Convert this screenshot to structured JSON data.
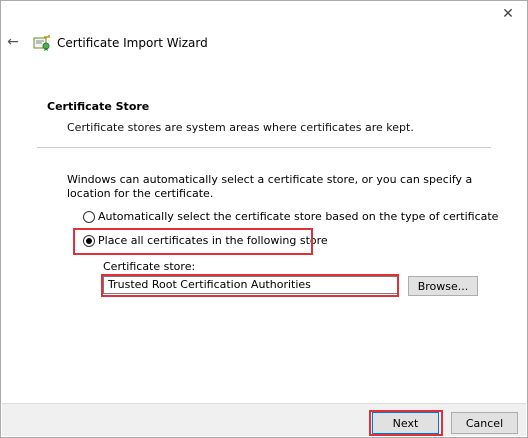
{
  "window": {
    "close_glyph": "✕",
    "back_glyph": "←"
  },
  "header": {
    "title": "Certificate Import Wizard",
    "icon": "certificate-wizard-icon"
  },
  "section": {
    "title": "Certificate Store",
    "description": "Certificate stores are system areas where certificates are kept."
  },
  "intro": "Windows can automatically select a certificate store, or you can specify a location for the certificate.",
  "options": {
    "auto_label": "Automatically select the certificate store based on the type of certificate",
    "auto_selected": false,
    "manual_label": "Place all certificates in the following store",
    "manual_selected": true
  },
  "store": {
    "label": "Certificate store:",
    "value": "Trusted Root Certification Authorities",
    "browse_label": "Browse..."
  },
  "footer": {
    "next_label": "Next",
    "cancel_label": "Cancel"
  },
  "colors": {
    "highlight": "#e0303a",
    "accent": "#0078d7"
  }
}
